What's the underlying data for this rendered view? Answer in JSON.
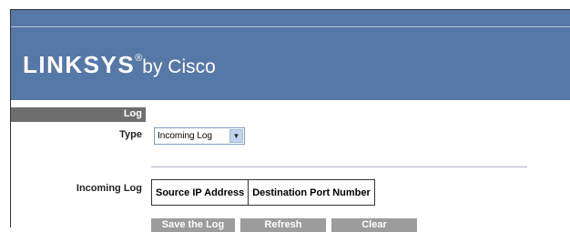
{
  "brand": {
    "logo_text": "LINKSYS",
    "registered": "®",
    "by_text": "by Cisco"
  },
  "sidebar": {
    "section_label": "Log",
    "type_label": "Type",
    "incoming_log_label": "Incoming Log"
  },
  "type_select": {
    "selected": "Incoming Log"
  },
  "log_table": {
    "columns": [
      "Source IP Address",
      "Destination Port Number"
    ]
  },
  "buttons": {
    "save": "Save the Log",
    "refresh": "Refresh",
    "clear": "Clear"
  },
  "colors": {
    "header": "#5678a6",
    "sidebar_bar": "#6e6e6e",
    "button": "#9c9c9c"
  }
}
